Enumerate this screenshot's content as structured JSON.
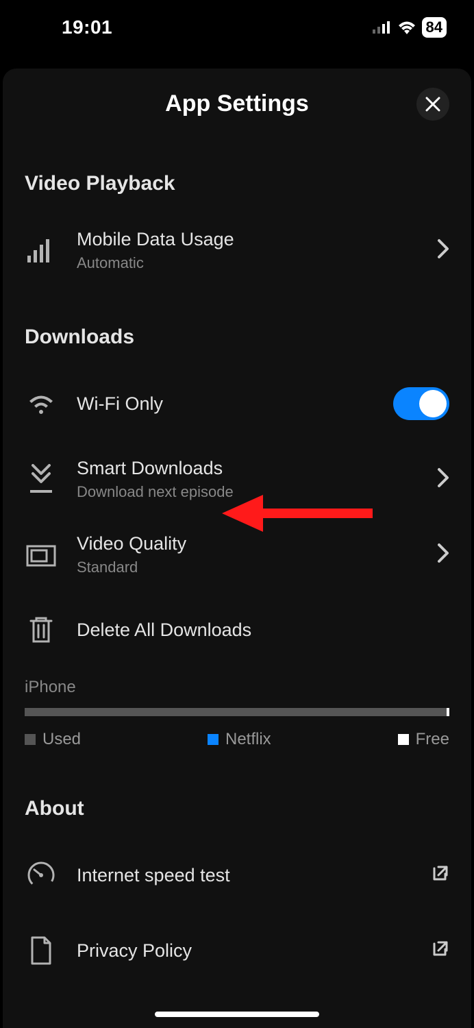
{
  "status": {
    "time": "19:01",
    "battery": "84"
  },
  "header": {
    "title": "App Settings"
  },
  "sections": {
    "video_playback": {
      "title": "Video Playback",
      "mobile_data": {
        "label": "Mobile Data Usage",
        "sub": "Automatic"
      }
    },
    "downloads": {
      "title": "Downloads",
      "wifi_only": {
        "label": "Wi-Fi Only"
      },
      "smart": {
        "label": "Smart Downloads",
        "sub": "Download next episode"
      },
      "video_quality": {
        "label": "Video Quality",
        "sub": "Standard"
      },
      "delete_all": {
        "label": "Delete All Downloads"
      }
    },
    "storage": {
      "device": "iPhone",
      "legend": {
        "used": "Used",
        "netflix": "Netflix",
        "free": "Free"
      }
    },
    "about": {
      "title": "About",
      "speed_test": {
        "label": "Internet speed test"
      },
      "privacy": {
        "label": "Privacy Policy"
      }
    }
  }
}
